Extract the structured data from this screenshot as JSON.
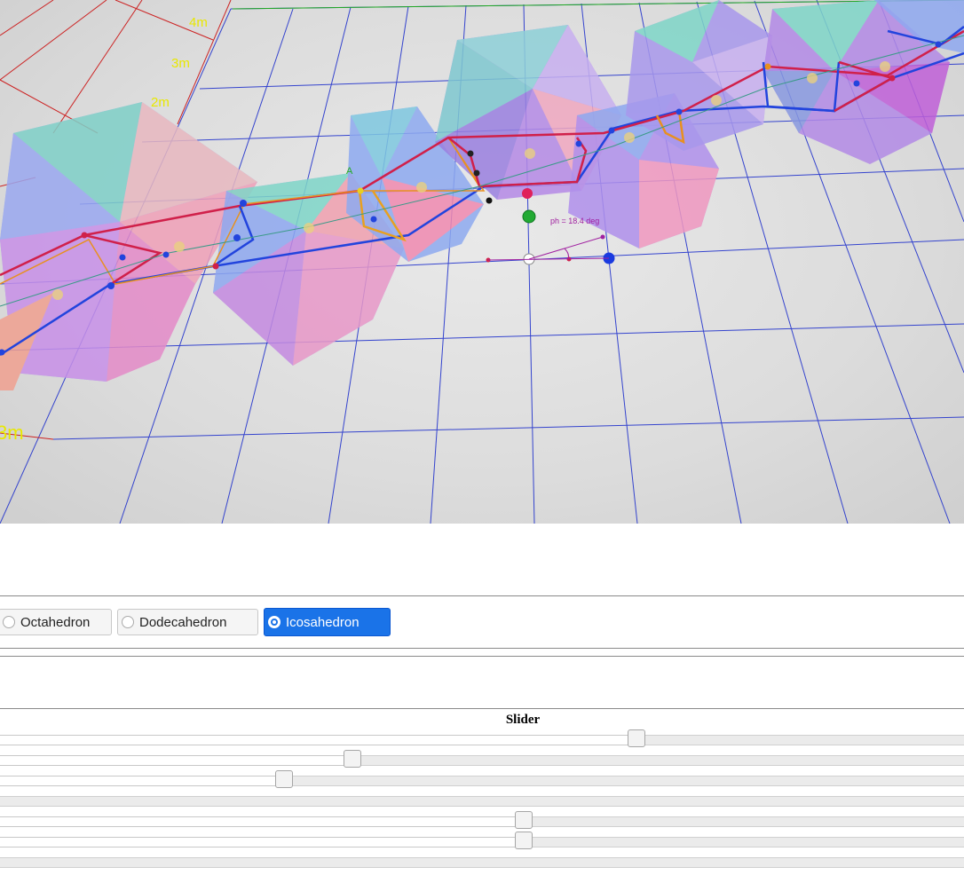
{
  "scene": {
    "axis_labels": [
      "4m",
      "3m",
      "2m",
      "3m"
    ],
    "point_labels": [
      "A"
    ],
    "angle_label": "ph = 18.4 deg",
    "colors": {
      "grid": "#2233cc",
      "grid_red": "#cc2222",
      "label": "#e8e800",
      "face_teal": "#7fd6c8",
      "face_blue": "#8ea8f0",
      "face_violet": "#b58ae6",
      "face_pink": "#f08ab0",
      "face_orange": "#f0a090",
      "edge_red": "#d0204a",
      "edge_blue": "#2244dd",
      "edge_orange": "#e89020"
    }
  },
  "shape_options": [
    {
      "label": "Octahedron",
      "selected": false
    },
    {
      "label": "Dodecahedron",
      "selected": false
    },
    {
      "label": "Icosahedron",
      "selected": true
    }
  ],
  "slider_panel": {
    "title": "Slider",
    "sliders": [
      {
        "value": 0.66,
        "visible_thumb": true
      },
      {
        "value": 0.366,
        "visible_thumb": true
      },
      {
        "value": 0.295,
        "visible_thumb": true
      },
      {
        "value": 0,
        "visible_thumb": false
      },
      {
        "value": 0.543,
        "visible_thumb": true
      },
      {
        "value": 0.543,
        "visible_thumb": true
      },
      {
        "value": 0,
        "visible_thumb": false
      }
    ]
  }
}
